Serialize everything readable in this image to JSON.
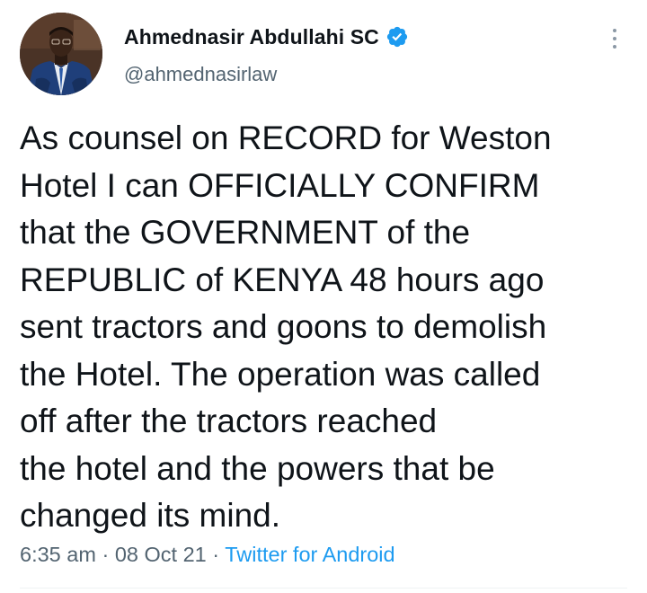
{
  "author": {
    "display_name": "Ahmednasir Abdullahi SC",
    "handle": "@ahmednasirlaw",
    "verified": true,
    "avatar_icon": "profile-photo"
  },
  "tweet": {
    "lines": [
      "As counsel on RECORD for Weston",
      "Hotel I can OFFICIALLY CONFIRM",
      "that the GOVERNMENT of the",
      "REPUBLIC of KENYA 48 hours ago",
      "sent tractors and goons to demolish",
      "the Hotel. The operation was called",
      "off after the tractors reached",
      "the hotel and the powers that be",
      "changed its mind."
    ]
  },
  "meta": {
    "time": "6:35 am",
    "separator": "·",
    "date": "08 Oct 21",
    "source": "Twitter for Android"
  },
  "colors": {
    "text": "#0f1419",
    "secondary": "#536471",
    "accent": "#1d9bf0"
  }
}
